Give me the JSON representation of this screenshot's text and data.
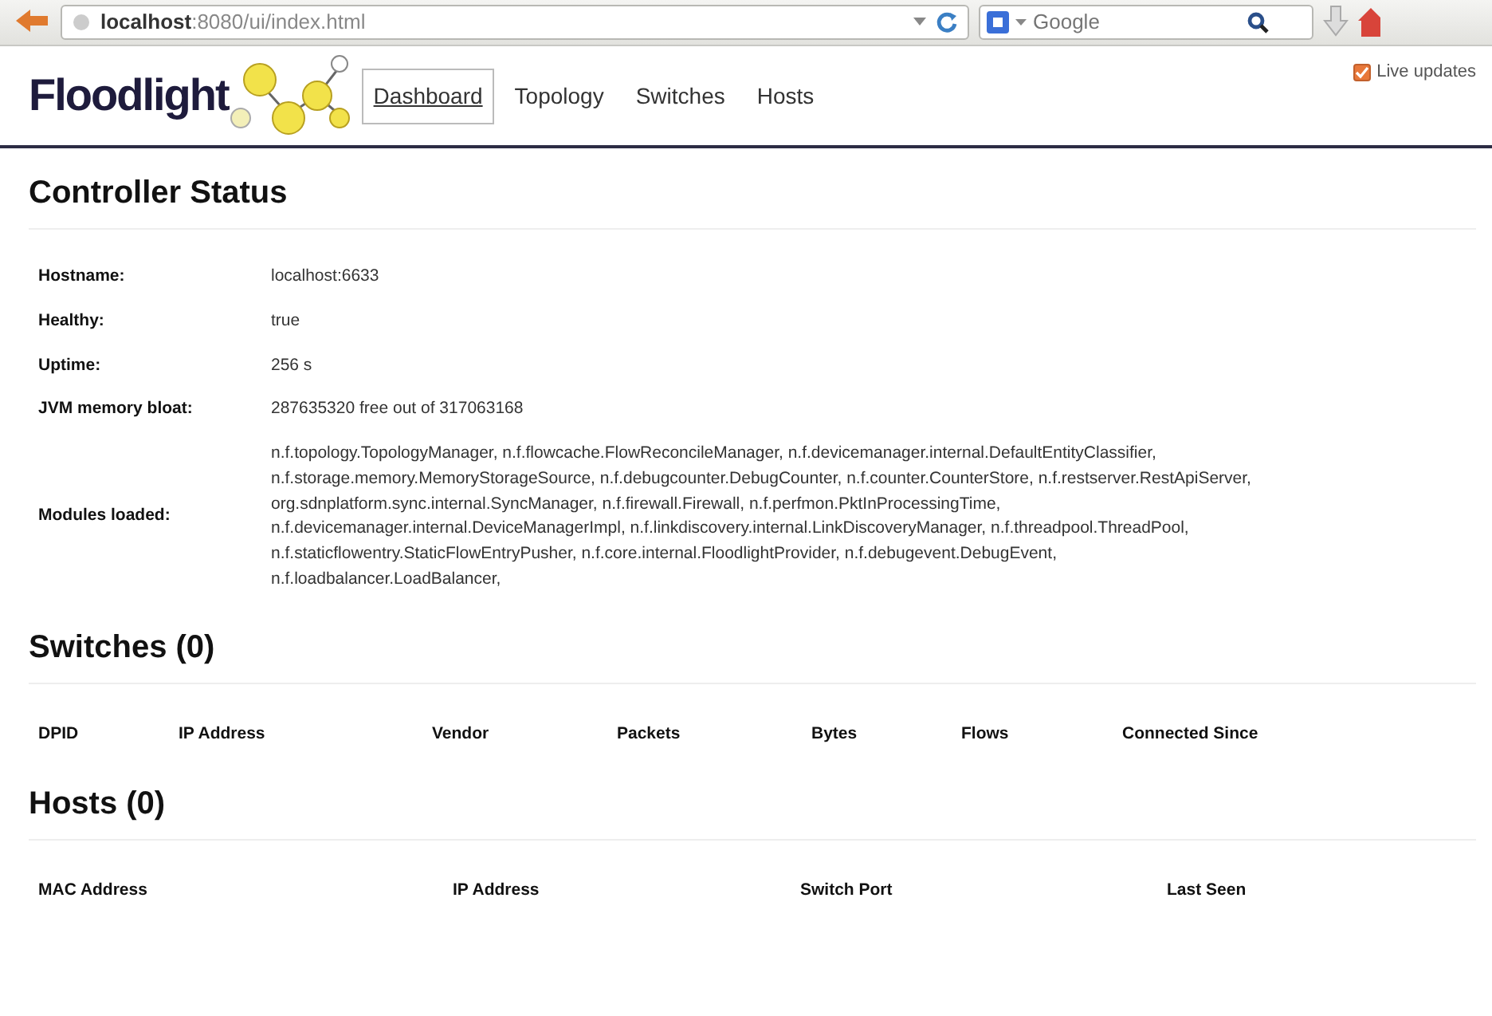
{
  "browser": {
    "url": "**localhost**:8080/ui/index.html",
    "search": {
      "placeholder": "Google"
    }
  },
  "navbar": {
    "brand": "Floodlight",
    "tabs": [
      {
        "label": "Dashboard",
        "selected": true
      },
      {
        "label": "Topology",
        "selected": false
      },
      {
        "label": "Switches",
        "selected": false
      },
      {
        "label": "Hosts",
        "selected": false
      }
    ],
    "live_updates": {
      "label": "Live updates",
      "checked": true
    }
  },
  "controller_status": {
    "title": "Controller Status",
    "rows": [
      {
        "label": "Hostname:",
        "value": [
          "localhost:6633"
        ]
      },
      {
        "label": "Healthy:",
        "value": [
          "true"
        ]
      },
      {
        "label": "Uptime:",
        "value": [
          "256 s"
        ]
      },
      {
        "label": "JVM memory bloat:",
        "value": [
          "287635320 free out of 317063168"
        ]
      },
      {
        "label": "Modules loaded:",
        "value": [
          "n.f.topology.TopologyManager, n.f.flowcache.FlowReconcileManager, n.f.devicemanager.internal.DefaultEntityClassifier,",
          "n.f.storage.memory.MemoryStorageSource, n.f.debugcounter.DebugCounter, n.f.counter.CounterStore, n.f.restserver.RestApiServer,",
          "org.sdnplatform.sync.internal.SyncManager, n.f.firewall.Firewall, n.f.perfmon.PktInProcessingTime,",
          "n.f.devicemanager.internal.DeviceManagerImpl, n.f.linkdiscovery.internal.LinkDiscoveryManager, n.f.threadpool.ThreadPool,",
          "n.f.staticflowentry.StaticFlowEntryPusher, n.f.core.internal.FloodlightProvider, n.f.debugevent.DebugEvent,",
          "n.f.loadbalancer.LoadBalancer,"
        ]
      }
    ]
  },
  "switches": {
    "title": "Switches (0)",
    "columns": [
      "DPID",
      "IP Address",
      "Vendor",
      "Packets",
      "Bytes",
      "Flows",
      "Connected Since"
    ]
  },
  "hosts": {
    "title": "Hosts (0)",
    "columns": [
      "MAC Address",
      "IP Address",
      "Switch Port",
      "Last Seen"
    ]
  }
}
